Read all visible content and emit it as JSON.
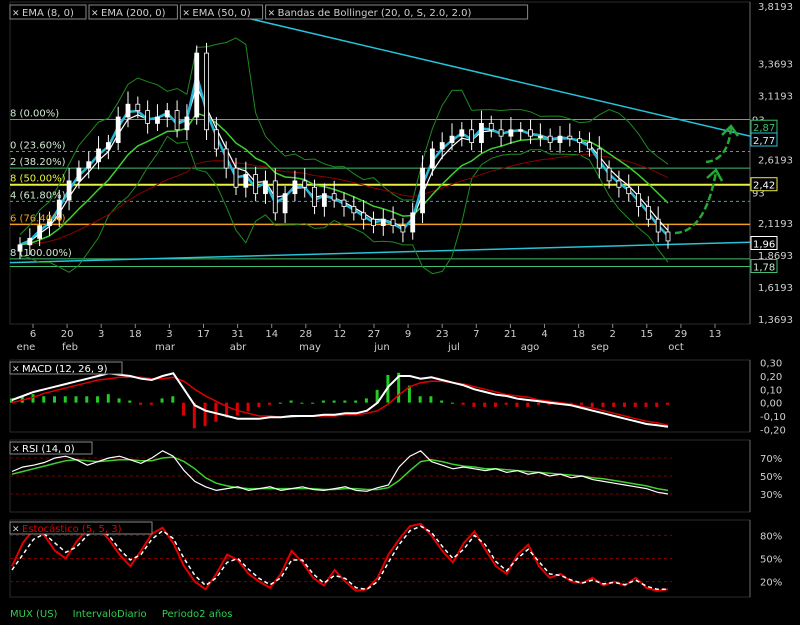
{
  "footer": {
    "symbol": "MUX (US)",
    "interval": "IntervaloDiario",
    "period": "Periodo2 años"
  },
  "colors": {
    "bg": "#000000",
    "panel_border": "#6a6a6a",
    "ema8": "#ffffff",
    "ema200": "#8b0000",
    "ema50": "#3fcf2f",
    "bollinger": "#1f8a1f",
    "price_ema_fast": "#26b8d6",
    "fib": "#3fbf6f",
    "fib_yellow": "#e8f040",
    "fib_orange": "#f0a020",
    "trend": "#27c3d8",
    "macd": "#ffffff",
    "macd_signal": "#e00000",
    "hist_pos": "#22cc22",
    "hist_neg": "#dd0000",
    "rsi_line": "#ffffff",
    "rsi_ma": "#3fcf2f",
    "stoch_k": "#e00000",
    "stoch_d": "#ffffff",
    "arrows": "#22aa33"
  },
  "chart_data": [
    {
      "type": "candlestick",
      "legend": [
        "EMA (8, 0)",
        "EMA (200, 0)",
        "EMA (50, 0)",
        "Bandas de Bollinger (20, 0, S, 2.0, 2.0)"
      ],
      "y_ticks": [
        "3,8193",
        "3,3693",
        "3,1193",
        "2,6193",
        "2,1193",
        "1,8693",
        "1,6193",
        "1,3693"
      ],
      "y_tick_values": [
        3.8193,
        3.3693,
        3.1193,
        2.6193,
        2.1193,
        1.8693,
        1.6193,
        1.3693
      ],
      "ylim": [
        1.33,
        3.85
      ],
      "x_ticks": [
        "6",
        "20",
        "3",
        "18",
        "3",
        "17",
        "31",
        "14",
        "28",
        "12",
        "27",
        "9",
        "23",
        "7",
        "21",
        "4",
        "18",
        "2",
        "15",
        "29",
        "13"
      ],
      "months": [
        "ene",
        "feb",
        "mar",
        "abr",
        "may",
        "jun",
        "jul",
        "ago",
        "sep",
        "oct"
      ],
      "fib_levels": [
        {
          "label": "8 (0.00%)",
          "value": 2.93
        },
        {
          "label": "0 (23.60%)",
          "value": 2.68
        },
        {
          "label": "2 (38.20%)",
          "value": 2.55
        },
        {
          "label": "8 (50.00%)",
          "value": 2.42
        },
        {
          "label": "4 (61.80%)",
          "value": 2.29
        },
        {
          "label": "6 (76.40%)",
          "value": 2.11
        },
        {
          "label": "8 (100.00%)",
          "value": 1.84
        }
      ],
      "price_tags": [
        "2,87",
        "2,77",
        "2,42",
        "1,96",
        "1,78"
      ],
      "right_partial_labels": [
        "93",
        "93"
      ],
      "closes": [
        1.95,
        2.0,
        2.1,
        2.15,
        2.3,
        2.45,
        2.55,
        2.6,
        2.7,
        2.75,
        2.95,
        3.05,
        3.0,
        2.9,
        2.95,
        3.0,
        2.85,
        2.95,
        3.45,
        2.85,
        2.7,
        2.55,
        2.4,
        2.5,
        2.35,
        2.45,
        2.2,
        2.35,
        2.45,
        2.4,
        2.25,
        2.35,
        2.3,
        2.25,
        2.2,
        2.15,
        2.1,
        2.15,
        2.1,
        2.05,
        2.2,
        2.55,
        2.7,
        2.75,
        2.8,
        2.85,
        2.75,
        2.9,
        2.85,
        2.8,
        2.85,
        2.85,
        2.8,
        2.8,
        2.75,
        2.8,
        2.78,
        2.75,
        2.7,
        2.55,
        2.45,
        2.4,
        2.35,
        2.25,
        2.15,
        2.05,
        1.98
      ]
    },
    {
      "type": "line",
      "name": "MACD (12, 26, 9)",
      "y_ticks": [
        "0,30",
        "0,20",
        "0,10",
        "0,00",
        "-0,10",
        "-0,20"
      ],
      "ylim": [
        -0.22,
        0.32
      ],
      "macd": [
        0.02,
        0.05,
        0.08,
        0.1,
        0.12,
        0.14,
        0.16,
        0.18,
        0.2,
        0.22,
        0.21,
        0.2,
        0.18,
        0.17,
        0.2,
        0.22,
        0.1,
        -0.02,
        -0.06,
        -0.08,
        -0.1,
        -0.12,
        -0.12,
        -0.12,
        -0.11,
        -0.11,
        -0.1,
        -0.1,
        -0.1,
        -0.09,
        -0.09,
        -0.08,
        -0.08,
        -0.06,
        0.0,
        0.12,
        0.2,
        0.2,
        0.18,
        0.19,
        0.17,
        0.15,
        0.13,
        0.1,
        0.08,
        0.06,
        0.05,
        0.03,
        0.02,
        0.01,
        0.0,
        -0.01,
        -0.02,
        -0.04,
        -0.06,
        -0.08,
        -0.1,
        -0.12,
        -0.14,
        -0.16,
        -0.17,
        -0.18
      ],
      "signal": [
        0.0,
        0.02,
        0.04,
        0.07,
        0.09,
        0.11,
        0.13,
        0.15,
        0.17,
        0.18,
        0.19,
        0.19,
        0.19,
        0.18,
        0.18,
        0.19,
        0.16,
        0.1,
        0.05,
        0.01,
        -0.03,
        -0.06,
        -0.08,
        -0.1,
        -0.1,
        -0.11,
        -0.11,
        -0.1,
        -0.1,
        -0.1,
        -0.1,
        -0.09,
        -0.09,
        -0.08,
        -0.06,
        -0.01,
        0.06,
        0.12,
        0.15,
        0.16,
        0.16,
        0.15,
        0.14,
        0.12,
        0.1,
        0.08,
        0.06,
        0.05,
        0.04,
        0.02,
        0.01,
        0.0,
        -0.01,
        -0.03,
        -0.04,
        -0.06,
        -0.08,
        -0.1,
        -0.12,
        -0.14,
        -0.15,
        -0.17
      ]
    },
    {
      "type": "line",
      "name": "RSI (14, 0)",
      "y_ticks": [
        "70%",
        "50%",
        "30%"
      ],
      "ylim": [
        10,
        90
      ],
      "rsi": [
        55,
        60,
        62,
        65,
        70,
        72,
        68,
        62,
        66,
        70,
        72,
        68,
        64,
        70,
        78,
        72,
        56,
        44,
        38,
        34,
        36,
        38,
        34,
        36,
        38,
        34,
        36,
        38,
        35,
        34,
        36,
        38,
        34,
        33,
        37,
        40,
        60,
        72,
        78,
        66,
        62,
        58,
        60,
        58,
        56,
        58,
        54,
        56,
        52,
        54,
        50,
        52,
        48,
        50,
        46,
        44,
        42,
        40,
        38,
        36,
        32,
        30
      ],
      "rsi_ma": [
        52,
        55,
        58,
        61,
        64,
        67,
        68,
        67,
        66,
        67,
        68,
        68,
        67,
        67,
        70,
        71,
        66,
        58,
        48,
        42,
        39,
        37,
        36,
        36,
        36,
        36,
        36,
        36,
        36,
        35,
        35,
        36,
        36,
        35,
        35,
        37,
        45,
        56,
        66,
        68,
        66,
        63,
        61,
        60,
        58,
        58,
        57,
        56,
        55,
        54,
        53,
        52,
        51,
        50,
        48,
        47,
        45,
        43,
        41,
        39,
        36,
        34
      ]
    },
    {
      "type": "line",
      "name": "Estocástico (5, 5, 3)",
      "y_ticks": [
        "80%",
        "50%",
        "20%"
      ],
      "ylim": [
        0,
        100
      ],
      "k": [
        40,
        70,
        88,
        80,
        60,
        50,
        72,
        88,
        90,
        75,
        55,
        40,
        60,
        82,
        90,
        70,
        40,
        20,
        10,
        30,
        55,
        48,
        30,
        20,
        12,
        30,
        60,
        45,
        25,
        15,
        35,
        20,
        8,
        10,
        25,
        55,
        75,
        92,
        95,
        80,
        60,
        45,
        70,
        85,
        62,
        40,
        30,
        55,
        68,
        40,
        25,
        30,
        20,
        18,
        25,
        15,
        20,
        15,
        25,
        12,
        8,
        10
      ],
      "d": [
        35,
        55,
        75,
        82,
        70,
        58,
        65,
        80,
        88,
        80,
        62,
        48,
        55,
        75,
        86,
        76,
        50,
        28,
        15,
        25,
        45,
        50,
        36,
        24,
        16,
        25,
        48,
        48,
        30,
        18,
        28,
        24,
        12,
        10,
        20,
        45,
        68,
        86,
        92,
        84,
        66,
        50,
        62,
        80,
        68,
        46,
        34,
        50,
        62,
        46,
        30,
        28,
        22,
        18,
        22,
        17,
        19,
        16,
        22,
        14,
        10,
        10
      ]
    }
  ]
}
